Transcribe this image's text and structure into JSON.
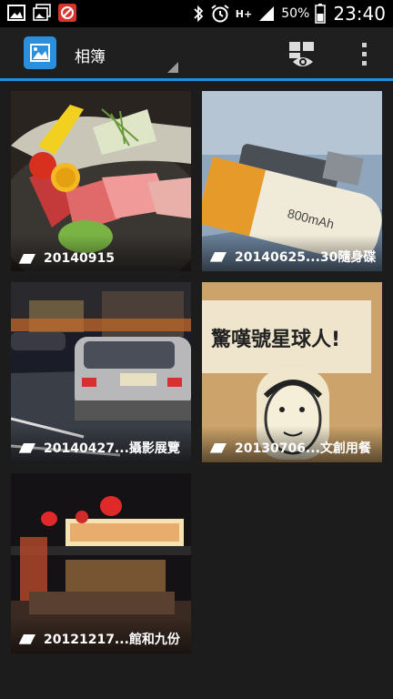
{
  "status_bar": {
    "network": "H+",
    "battery": "50%",
    "time": "23:40"
  },
  "action_bar": {
    "title": "相簿"
  },
  "albums": [
    {
      "label": "20140915"
    },
    {
      "label": "20140625...30隨身碟"
    },
    {
      "label": "20140427...攝影展覽"
    },
    {
      "label": "20130706...文創用餐"
    },
    {
      "label": "20121217...館和九份"
    }
  ],
  "colors": {
    "accent": "#1e90e0",
    "app_icon": "#2a8fdc",
    "background": "#1c1c1c"
  },
  "icons": [
    "gallery-icon",
    "album-icon",
    "slideshow-icon",
    "overflow-menu-icon",
    "bluetooth-icon",
    "alarm-icon",
    "signal-icon",
    "battery-icon"
  ]
}
